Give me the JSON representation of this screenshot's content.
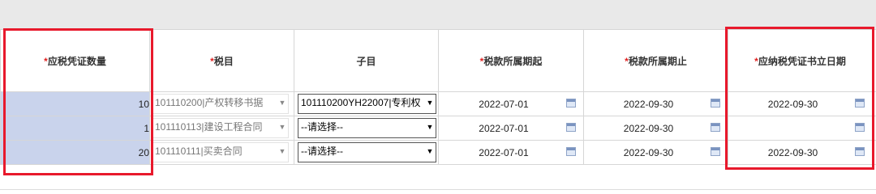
{
  "table": {
    "headers": {
      "required_mark": "*",
      "qty": "应税凭证数量",
      "item": "税目",
      "subitem": "子目",
      "start": "税款所属期起",
      "end": "税款所属期止",
      "date": "应纳税凭证书立日期"
    },
    "rows": [
      {
        "qty": "10",
        "item": "101110200|产权转移书据",
        "subitem": "101110200YH22007|专利权",
        "start": "2022-07-01",
        "end": "2022-09-30",
        "date": "2022-09-30"
      },
      {
        "qty": "1",
        "item": "101110113|建设工程合同",
        "subitem": "--请选择--",
        "start": "2022-07-01",
        "end": "2022-09-30",
        "date": ""
      },
      {
        "qty": "20",
        "item": "101110111|买卖合同",
        "subitem": "--请选择--",
        "start": "2022-07-01",
        "end": "2022-09-30",
        "date": "2022-09-30"
      }
    ]
  },
  "icons": {
    "dropdown": "chevron-down-icon",
    "calendar": "calendar-icon"
  },
  "colors": {
    "highlight": "#e8192c",
    "qty_fill": "#c9d3ec",
    "required": "#e02020"
  }
}
